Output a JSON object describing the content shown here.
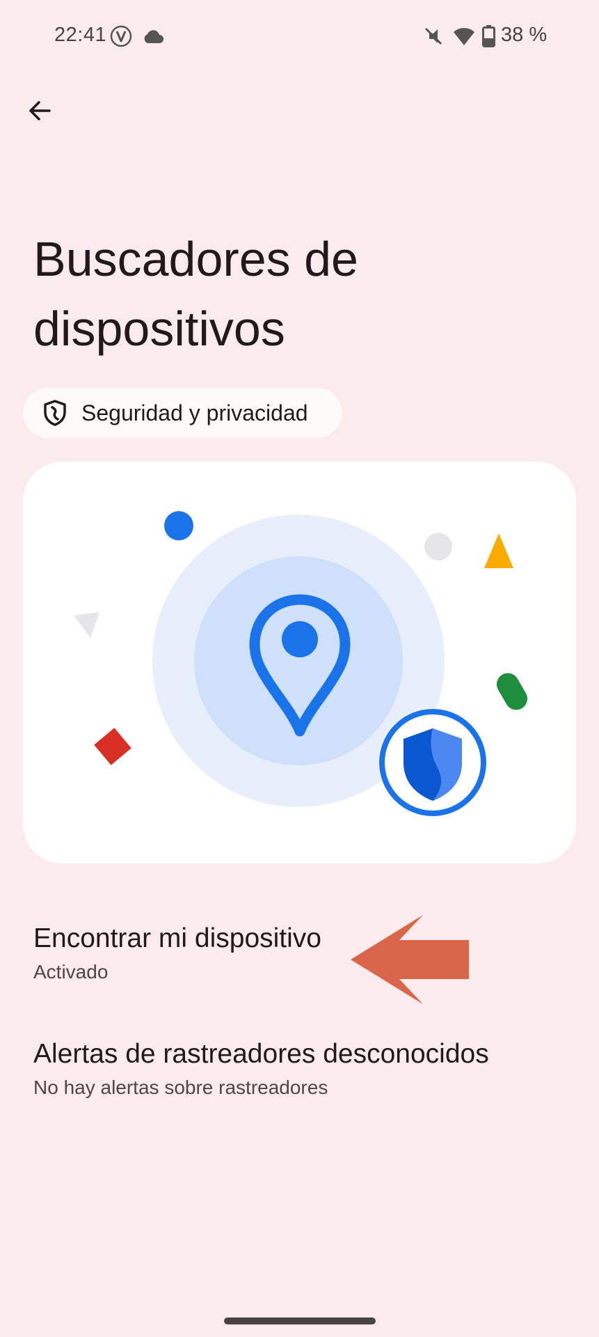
{
  "status_bar": {
    "time": "22:41",
    "battery_text": "38 %",
    "icons": [
      "vpn-v-icon",
      "cloud-icon",
      "mute-icon",
      "wifi-icon",
      "battery-icon"
    ]
  },
  "header": {
    "back_icon": "arrow-left-icon",
    "title": "Buscadores de dispositivos"
  },
  "chip": {
    "icon": "shield-icon",
    "label": "Seguridad y privacidad"
  },
  "illustration": {
    "icon": "location-pin-shield-illustration"
  },
  "list": [
    {
      "title": "Encontrar mi dispositivo",
      "subtitle": "Activado"
    },
    {
      "title": "Alertas de rastreadores desconocidos",
      "subtitle": "No hay alertas sobre rastreadores"
    }
  ],
  "colors": {
    "background": "#fcebec",
    "card": "#ffffff",
    "accent_blue": "#1a73e8",
    "annotation_arrow": "#d9654a"
  }
}
